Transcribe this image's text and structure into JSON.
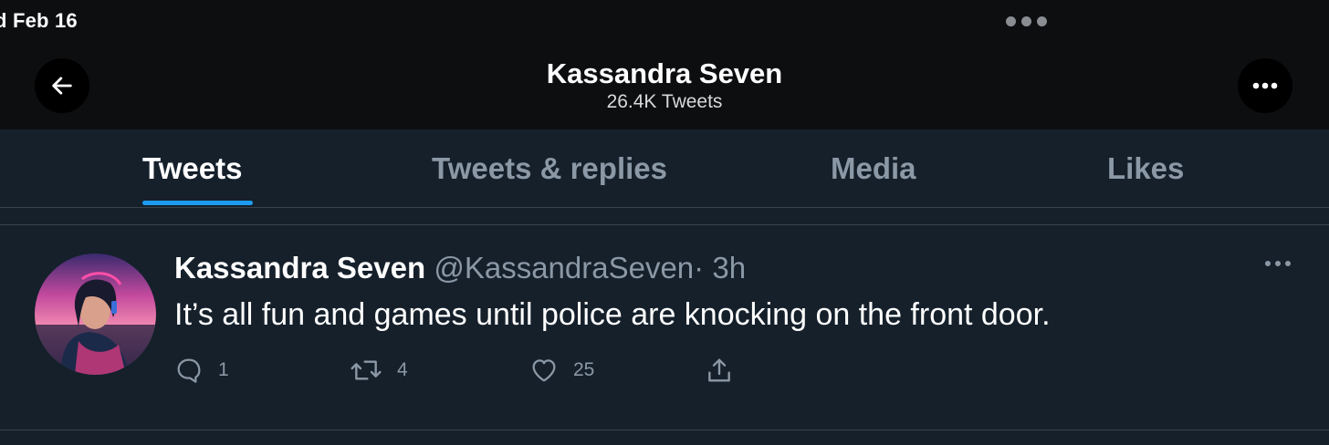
{
  "status_bar": {
    "date": "d Feb 16"
  },
  "header": {
    "title": "Kassandra Seven",
    "subtitle": "26.4K Tweets"
  },
  "tabs": [
    {
      "label": "Tweets",
      "active": true
    },
    {
      "label": "Tweets & replies",
      "active": false
    },
    {
      "label": "Media",
      "active": false
    },
    {
      "label": "Likes",
      "active": false
    }
  ],
  "colors": {
    "accent": "#1d9bf0",
    "background": "#15202b",
    "header_bg": "#0d0e10",
    "muted": "#8b98a5"
  },
  "tweet": {
    "author_name": "Kassandra Seven",
    "handle": "@KassandraSeven",
    "separator": "·",
    "time": "3h",
    "text": "It’s all fun and games until police are knocking on the front door.",
    "actions": {
      "reply_count": "1",
      "retweet_count": "4",
      "like_count": "25"
    }
  },
  "icons": {
    "back": "arrow-left-icon",
    "more": "more-horizontal-icon",
    "reply": "comment-bubble-icon",
    "retweet": "retweet-icon",
    "like": "heart-icon",
    "share": "share-upload-icon"
  }
}
